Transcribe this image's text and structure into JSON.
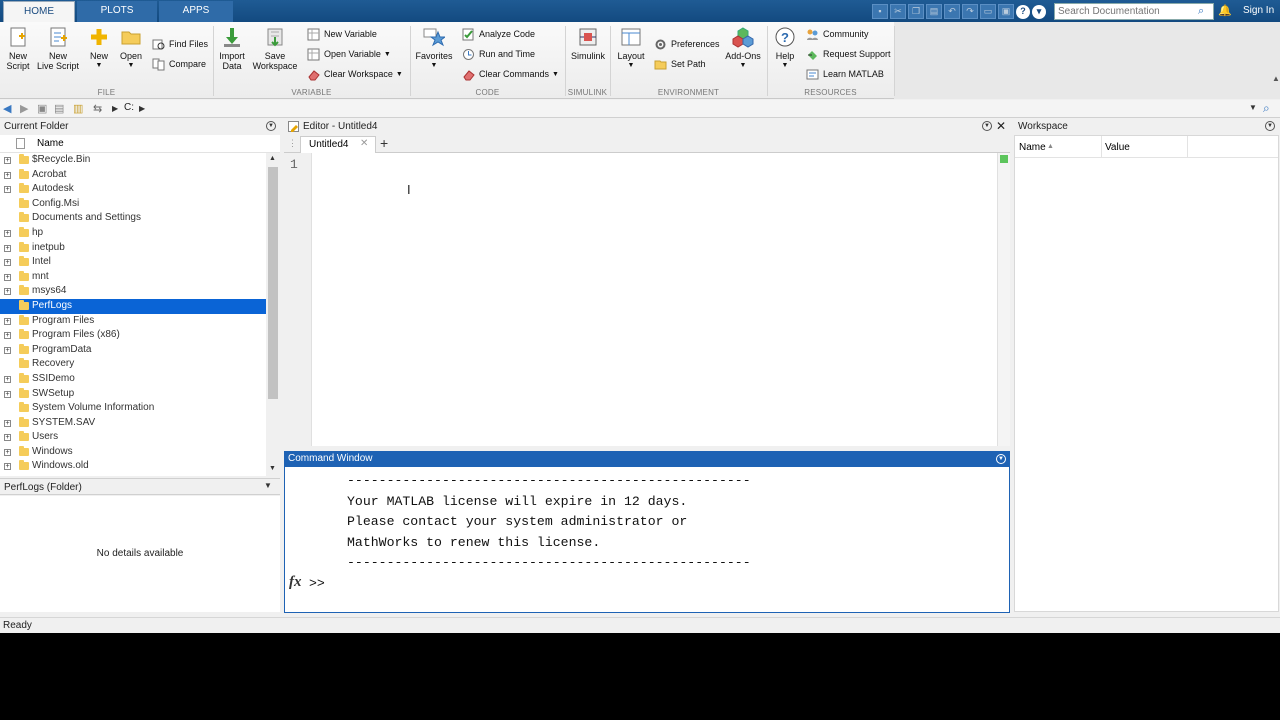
{
  "tabs": [
    {
      "label": "HOME",
      "active": true
    },
    {
      "label": "PLOTS",
      "active": false
    },
    {
      "label": "APPS",
      "active": false
    }
  ],
  "search": {
    "placeholder": "Search Documentation"
  },
  "sign_in": "Sign In",
  "ribbon": {
    "file": {
      "label": "FILE",
      "new_script": [
        "New",
        "Script"
      ],
      "new_live_script": [
        "New",
        "Live Script"
      ],
      "new": "New",
      "open": "Open",
      "find_files": "Find Files",
      "compare": "Compare"
    },
    "variable": {
      "label": "VARIABLE",
      "import_data": [
        "Import",
        "Data"
      ],
      "save_workspace": [
        "Save",
        "Workspace"
      ],
      "new_variable": "New Variable",
      "open_variable": "Open Variable",
      "clear_workspace": "Clear Workspace"
    },
    "code": {
      "label": "CODE",
      "favorites": "Favorites",
      "analyze_code": "Analyze Code",
      "run_and_time": "Run and Time",
      "clear_commands": "Clear Commands"
    },
    "simulink": {
      "label": "SIMULINK",
      "simulink": "Simulink"
    },
    "environment": {
      "label": "ENVIRONMENT",
      "layout": "Layout",
      "preferences": "Preferences",
      "set_path": "Set Path",
      "add_ons": "Add-Ons"
    },
    "resources": {
      "label": "RESOURCES",
      "help": "Help",
      "community": "Community",
      "request_support": "Request Support",
      "learn_matlab": "Learn MATLAB"
    }
  },
  "address": {
    "path": "C:"
  },
  "current_folder": {
    "title": "Current Folder",
    "column_name": "Name",
    "items": [
      {
        "name": "$Recycle.Bin",
        "expandable": true,
        "selected": false
      },
      {
        "name": "Acrobat",
        "expandable": true,
        "selected": false
      },
      {
        "name": "Autodesk",
        "expandable": true,
        "selected": false
      },
      {
        "name": "Config.Msi",
        "expandable": false,
        "selected": false
      },
      {
        "name": "Documents and Settings",
        "expandable": false,
        "selected": false
      },
      {
        "name": "hp",
        "expandable": true,
        "selected": false
      },
      {
        "name": "inetpub",
        "expandable": true,
        "selected": false
      },
      {
        "name": "Intel",
        "expandable": true,
        "selected": false
      },
      {
        "name": "mnt",
        "expandable": true,
        "selected": false
      },
      {
        "name": "msys64",
        "expandable": true,
        "selected": false
      },
      {
        "name": "PerfLogs",
        "expandable": false,
        "selected": true
      },
      {
        "name": "Program Files",
        "expandable": true,
        "selected": false
      },
      {
        "name": "Program Files (x86)",
        "expandable": true,
        "selected": false
      },
      {
        "name": "ProgramData",
        "expandable": true,
        "selected": false
      },
      {
        "name": "Recovery",
        "expandable": false,
        "selected": false
      },
      {
        "name": "SSIDemo",
        "expandable": true,
        "selected": false
      },
      {
        "name": "SWSetup",
        "expandable": true,
        "selected": false
      },
      {
        "name": "System Volume Information",
        "expandable": false,
        "selected": false
      },
      {
        "name": "SYSTEM.SAV",
        "expandable": true,
        "selected": false
      },
      {
        "name": "Users",
        "expandable": true,
        "selected": false
      },
      {
        "name": "Windows",
        "expandable": true,
        "selected": false
      },
      {
        "name": "Windows.old",
        "expandable": true,
        "selected": false
      }
    ]
  },
  "details": {
    "title": "PerfLogs  (Folder)",
    "empty_text": "No details available"
  },
  "editor": {
    "title": "Editor - Untitled4",
    "tab": "Untitled4",
    "line_number": "1"
  },
  "command_window": {
    "title": "Command Window",
    "lines": [
      "---------------------------------------------------",
      "Your MATLAB license will expire in 12 days.",
      "Please contact your system administrator or",
      "MathWorks to renew this license.",
      "---------------------------------------------------"
    ],
    "fx": "fx",
    "prompt": ">>"
  },
  "workspace": {
    "title": "Workspace",
    "col_name": "Name",
    "col_value": "Value"
  },
  "status": "Ready"
}
